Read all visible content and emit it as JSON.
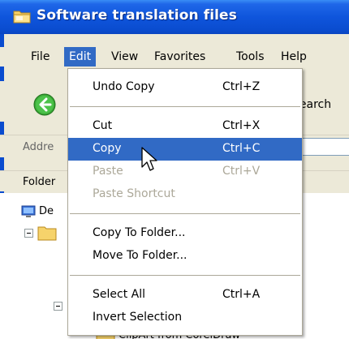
{
  "window": {
    "title": "Software translation files",
    "title_icon": "folder-icon"
  },
  "menubar": {
    "items": [
      "File",
      "Edit",
      "View",
      "Favorites",
      "Tools",
      "Help"
    ],
    "active": "Edit"
  },
  "toolbar": {
    "back_icon": "back-arrow-icon",
    "search_text": "Search"
  },
  "address": {
    "label": "Addre",
    "value": "s"
  },
  "folders": {
    "label": "Folder",
    "tree_items": [
      {
        "icon": "desktop-icon",
        "label": "De"
      },
      {
        "icon": "folder-icon",
        "label": ""
      },
      {
        "icon": "folder-icon",
        "label": ""
      },
      {
        "icon": "folder-icon",
        "label": "ClipArt from CorelDraw"
      }
    ]
  },
  "edit_menu": {
    "items": [
      {
        "label": "Undo Copy",
        "shortcut": "Ctrl+Z",
        "enabled": true
      },
      {
        "label": "Cut",
        "shortcut": "Ctrl+X",
        "enabled": true
      },
      {
        "label": "Copy",
        "shortcut": "Ctrl+C",
        "enabled": true,
        "highlighted": true
      },
      {
        "label": "Paste",
        "shortcut": "Ctrl+V",
        "enabled": false
      },
      {
        "label": "Paste Shortcut",
        "shortcut": "",
        "enabled": false
      },
      {
        "label": "Copy To Folder...",
        "shortcut": "",
        "enabled": true
      },
      {
        "label": "Move To Folder...",
        "shortcut": "",
        "enabled": true
      },
      {
        "label": "Select All",
        "shortcut": "Ctrl+A",
        "enabled": true
      },
      {
        "label": "Invert Selection",
        "shortcut": "",
        "enabled": true
      }
    ]
  },
  "colors": {
    "titlebar": "#0a4ccf",
    "menu_highlight": "#316ac5",
    "disabled_text": "#aca899",
    "chrome": "#ece9d8",
    "back_button": "#3aa836"
  }
}
